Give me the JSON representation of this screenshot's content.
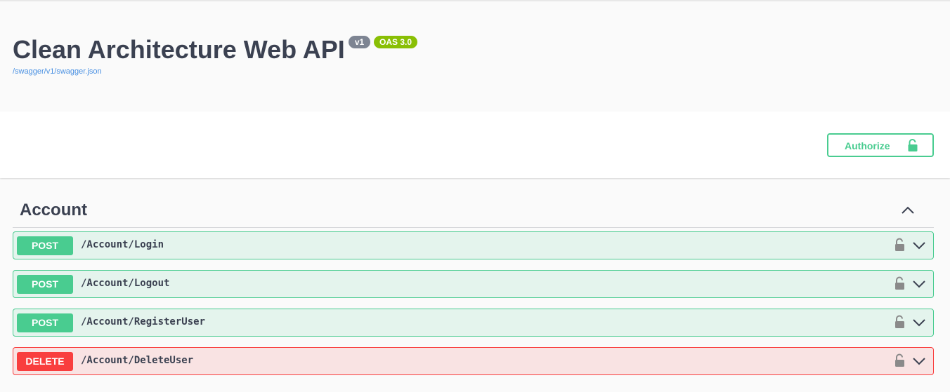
{
  "info": {
    "title": "Clean Architecture Web API",
    "version_badge": "v1",
    "oas_badge": "OAS 3.0",
    "spec_link": "/swagger/v1/swagger.json"
  },
  "authorize": {
    "label": "Authorize",
    "icon": "unlocked-icon"
  },
  "tag": {
    "name": "Account",
    "expanded": true,
    "operations": [
      {
        "method": "POST",
        "path": "/Account/Login"
      },
      {
        "method": "POST",
        "path": "/Account/Logout"
      },
      {
        "method": "POST",
        "path": "/Account/RegisterUser"
      },
      {
        "method": "DELETE",
        "path": "/Account/DeleteUser"
      }
    ]
  },
  "colors": {
    "post": "#49cc90",
    "delete": "#f93e3e",
    "link": "#4990e2",
    "version_badge": "#7d8492",
    "oas_badge": "#89bf04"
  }
}
